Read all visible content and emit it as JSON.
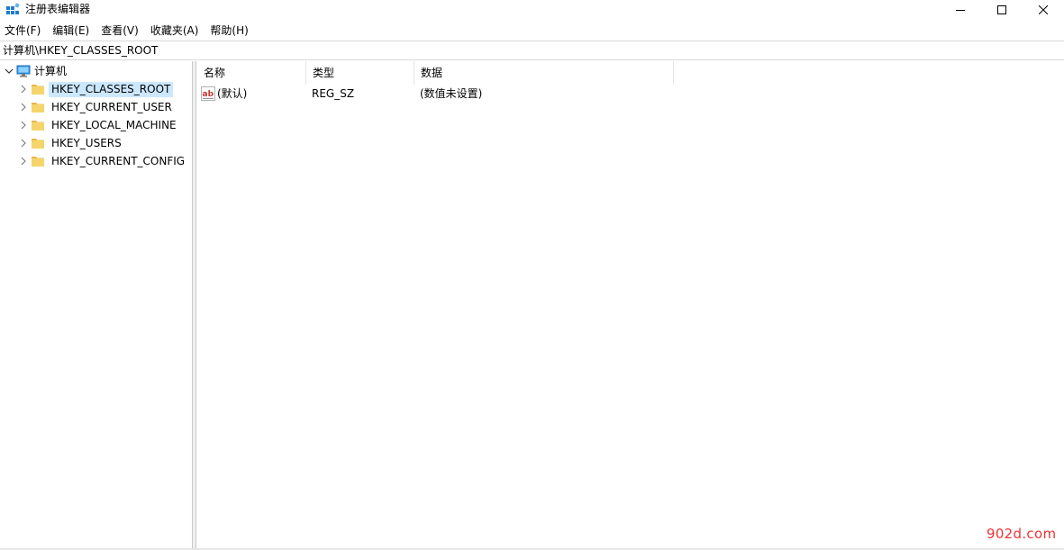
{
  "window": {
    "title": "注册表编辑器",
    "controls": {
      "minimize": "minimize",
      "maximize": "maximize",
      "close": "close"
    }
  },
  "menu": [
    {
      "label": "文件(F)"
    },
    {
      "label": "编辑(E)"
    },
    {
      "label": "查看(V)"
    },
    {
      "label": "收藏夹(A)"
    },
    {
      "label": "帮助(H)"
    }
  ],
  "address": {
    "path": "计算机\\HKEY_CLASSES_ROOT"
  },
  "tree": {
    "root": {
      "label": "计算机",
      "icon": "computer-icon",
      "expanded": true
    },
    "items": [
      {
        "label": "HKEY_CLASSES_ROOT",
        "icon": "folder-icon",
        "selected": true
      },
      {
        "label": "HKEY_CURRENT_USER",
        "icon": "folder-icon"
      },
      {
        "label": "HKEY_LOCAL_MACHINE",
        "icon": "folder-icon"
      },
      {
        "label": "HKEY_USERS",
        "icon": "folder-icon"
      },
      {
        "label": "HKEY_CURRENT_CONFIG",
        "icon": "folder-icon"
      }
    ]
  },
  "list": {
    "columns": {
      "name": "名称",
      "type": "类型",
      "data": "数据"
    },
    "rows": [
      {
        "name": "(默认)",
        "type": "REG_SZ",
        "data": "(数值未设置)",
        "icon": "string-value-icon"
      }
    ]
  },
  "colors": {
    "selection": "#cce8ff",
    "folder": "#f5d56b",
    "watermark": "#ee3333"
  },
  "watermark": "902d.com"
}
